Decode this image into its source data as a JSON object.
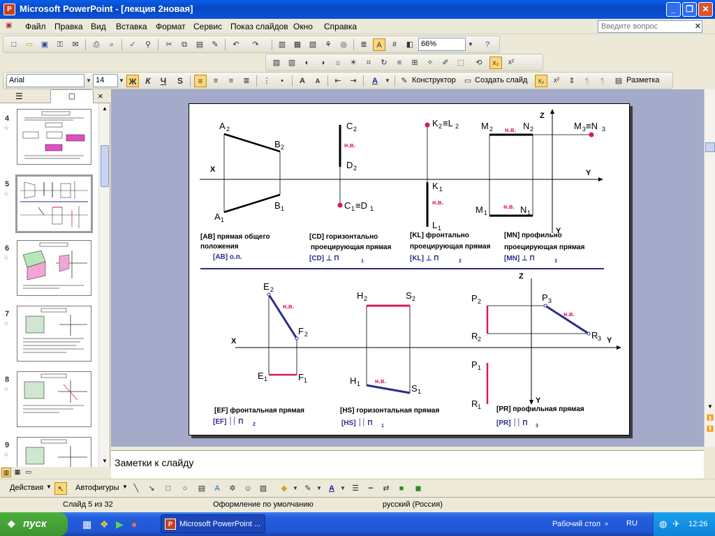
{
  "window": {
    "title": "Microsoft PowerPoint - [лекция 2новая]",
    "min_symbol": "_",
    "restore_symbol": "❐",
    "close_symbol": "✕"
  },
  "menu": {
    "items": [
      "Файл",
      "Правка",
      "Вид",
      "Вставка",
      "Формат",
      "Сервис",
      "Показ слайдов",
      "Окно",
      "Справка"
    ],
    "ask_placeholder": "Введите вопрос",
    "close_symbol": "×"
  },
  "toolbar": {
    "zoom": "66%",
    "font_name": "Arial",
    "font_size": "14",
    "bold": "Ж",
    "italic": "К",
    "underline": "Ч",
    "shadow": "S",
    "designer": "Конструктор",
    "new_slide": "Создать слайд",
    "layout": "Разметка"
  },
  "left_pane": {
    "slides": [
      {
        "num": "4"
      },
      {
        "num": "5"
      },
      {
        "num": "6"
      },
      {
        "num": "7"
      },
      {
        "num": "8"
      },
      {
        "num": "9"
      }
    ]
  },
  "slide": {
    "labels": {
      "A2": "A",
      "A2s": "2",
      "B2": "B",
      "B2s": "2",
      "A1": "A",
      "A1s": "1",
      "B1": "B",
      "B1s": "1",
      "C2": "C",
      "C2s": "2",
      "D2": "D",
      "D2s": "2",
      "C1D1": "C",
      "C1s": "1",
      "C1D1b": "≡D",
      "D1s": "1",
      "K2L2": "K",
      "K2s": "2",
      "K2L2b": "≡L",
      "L2s": "2",
      "K1": "K",
      "K1s": "1",
      "L1": "L",
      "L1s": "1",
      "M2": "M",
      "M2s": "2",
      "N2": "N",
      "N2s": "2",
      "M3N3": "M",
      "M3s": "3",
      "M3N3b": "≡N",
      "N3s": "3",
      "M1": "M",
      "M1s": "1",
      "N1": "N",
      "N1s": "1",
      "E2": "E",
      "E2s": "2",
      "F2": "F",
      "F2s": "2",
      "E1": "E",
      "E1s": "1",
      "F1": "F",
      "F1s": "1",
      "H2": "H",
      "H2s": "2",
      "S2": "S",
      "S2s": "2",
      "H1": "H",
      "H1s": "1",
      "S1": "S",
      "S1s": "1",
      "P2": "P",
      "P2s": "2",
      "P3": "P",
      "P3s": "3",
      "R2": "R",
      "R2s": "2",
      "R3": "R",
      "R3s": "3",
      "P1": "P",
      "P1s": "1",
      "R1": "R",
      "R1s": "1",
      "X": "X",
      "Y": "Y",
      "Z": "Z",
      "nv": "н.в."
    },
    "captions": {
      "ab1": "[AB] прямая общего",
      "ab2": "положения",
      "ab3": "[AB]  о.п.",
      "cd1": "[CD] горизонтально",
      "cd2": "проецирующая прямая",
      "cd3": "[CD]     ⊥  П",
      "cd3s": "1",
      "kl1": "[KL] фронтально",
      "kl2": "проецирующая прямая",
      "kl3": "[KL]      ⊥  П",
      "kl3s": "2",
      "mn1": "[MN] профильно",
      "mn2": "проецирующая прямая",
      "mn3": "[MN]      ⊥  П",
      "mn3s": "3",
      "ef1": "[EF] фронтальная  прямая",
      "ef2": "[EF]   ׀׀ П",
      "ef2s": "2",
      "hs1": "[HS] горизонтальная  прямая",
      "hs2": "[HS]   ׀׀ П",
      "hs2s": "1",
      "pr1": "[PR] профильная  прямая",
      "pr2": "[PR]   ׀׀ П",
      "pr2s": "3"
    }
  },
  "notes": {
    "placeholder": "Заметки к слайду"
  },
  "drawing_toolbar": {
    "actions": "Действия",
    "autoshapes": "Автофигуры"
  },
  "status": {
    "slide": "Слайд 5 из 32",
    "design": "Оформление по умолчанию",
    "language": "русский (Россия)"
  },
  "taskbar": {
    "start": "пуск",
    "task": "Microsoft PowerPoint ...",
    "desktop": "Рабочий стол",
    "lang": "RU",
    "time": "12:26"
  },
  "colors": {
    "accent_pink": "#d8195a",
    "caption_blue": "#2b2b8a",
    "divider": "#2b2b8a"
  }
}
